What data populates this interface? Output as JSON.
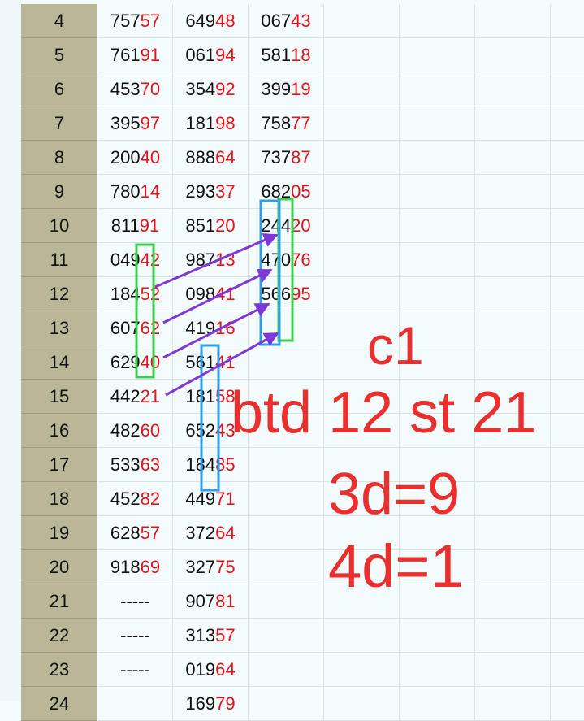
{
  "rows": [
    {
      "num": "4",
      "c1a": "757",
      "c1b": "57",
      "c2a": "649",
      "c2b": "48",
      "c3a": "067",
      "c3b": "43"
    },
    {
      "num": "5",
      "c1a": "761",
      "c1b": "91",
      "c2a": "061",
      "c2b": "94",
      "c3a": "581",
      "c3b": "18"
    },
    {
      "num": "6",
      "c1a": "453",
      "c1b": "70",
      "c2a": "354",
      "c2b": "92",
      "c3a": "399",
      "c3b": "19"
    },
    {
      "num": "7",
      "c1a": "395",
      "c1b": "97",
      "c2a": "181",
      "c2b": "98",
      "c3a": "758",
      "c3b": "77"
    },
    {
      "num": "8",
      "c1a": "200",
      "c1b": "40",
      "c2a": "888",
      "c2b": "64",
      "c3a": "737",
      "c3b": "87"
    },
    {
      "num": "9",
      "c1a": "780",
      "c1b": "14",
      "c2a": "293",
      "c2b": "37",
      "c3a": "682",
      "c3b": "05"
    },
    {
      "num": "10",
      "c1a": "811",
      "c1b": "91",
      "c2a": "851",
      "c2b": "20",
      "c3a": "244",
      "c3b": "20"
    },
    {
      "num": "11",
      "c1a": "049",
      "c1b": "42",
      "c2a": "987",
      "c2b": "13",
      "c3a": "470",
      "c3b": "76"
    },
    {
      "num": "12",
      "c1a": "184",
      "c1b": "52",
      "c2a": "098",
      "c2b": "41",
      "c3a": "566",
      "c3b": "95"
    },
    {
      "num": "13",
      "c1a": "607",
      "c1b": "62",
      "c2a": "419",
      "c2b": "16",
      "c3a": "",
      "c3b": ""
    },
    {
      "num": "14",
      "c1a": "629",
      "c1b": "40",
      "c2a": "561",
      "c2b": "41",
      "c3a": "",
      "c3b": ""
    },
    {
      "num": "15",
      "c1a": "442",
      "c1b": "21",
      "c2a": "181",
      "c2b": "58",
      "c3a": "",
      "c3b": ""
    },
    {
      "num": "16",
      "c1a": "482",
      "c1b": "60",
      "c2a": "652",
      "c2b": "43",
      "c3a": "",
      "c3b": ""
    },
    {
      "num": "17",
      "c1a": "533",
      "c1b": "63",
      "c2a": "184",
      "c2b": "85",
      "c3a": "",
      "c3b": ""
    },
    {
      "num": "18",
      "c1a": "452",
      "c1b": "82",
      "c2a": "449",
      "c2b": "71",
      "c3a": "",
      "c3b": ""
    },
    {
      "num": "19",
      "c1a": "628",
      "c1b": "57",
      "c2a": "372",
      "c2b": "64",
      "c3a": "",
      "c3b": ""
    },
    {
      "num": "20",
      "c1a": "918",
      "c1b": "69",
      "c2a": "327",
      "c2b": "75",
      "c3a": "",
      "c3b": ""
    },
    {
      "num": "21",
      "c1a": "-----",
      "c1b": "",
      "c2a": "907",
      "c2b": "81",
      "c3a": "",
      "c3b": ""
    },
    {
      "num": "22",
      "c1a": "-----",
      "c1b": "",
      "c2a": "313",
      "c2b": "57",
      "c3a": "",
      "c3b": ""
    },
    {
      "num": "23",
      "c1a": "-----",
      "c1b": "",
      "c2a": "019",
      "c2b": "64",
      "c3a": "",
      "c3b": ""
    },
    {
      "num": "24",
      "c1a": "",
      "c1b": "",
      "c2a": "169",
      "c2b": "79",
      "c3a": "",
      "c3b": ""
    }
  ],
  "notes": {
    "line1": "c1",
    "line2": "btd 12 st 21",
    "line3": "3d=9",
    "line4": "4d=1"
  },
  "colors": {
    "red_digits": "#e2141b",
    "note_text": "#ea2f2f",
    "green_box": "#3ccf4e",
    "blue_box": "#2f9ee6",
    "arrow": "#7e38d8"
  }
}
